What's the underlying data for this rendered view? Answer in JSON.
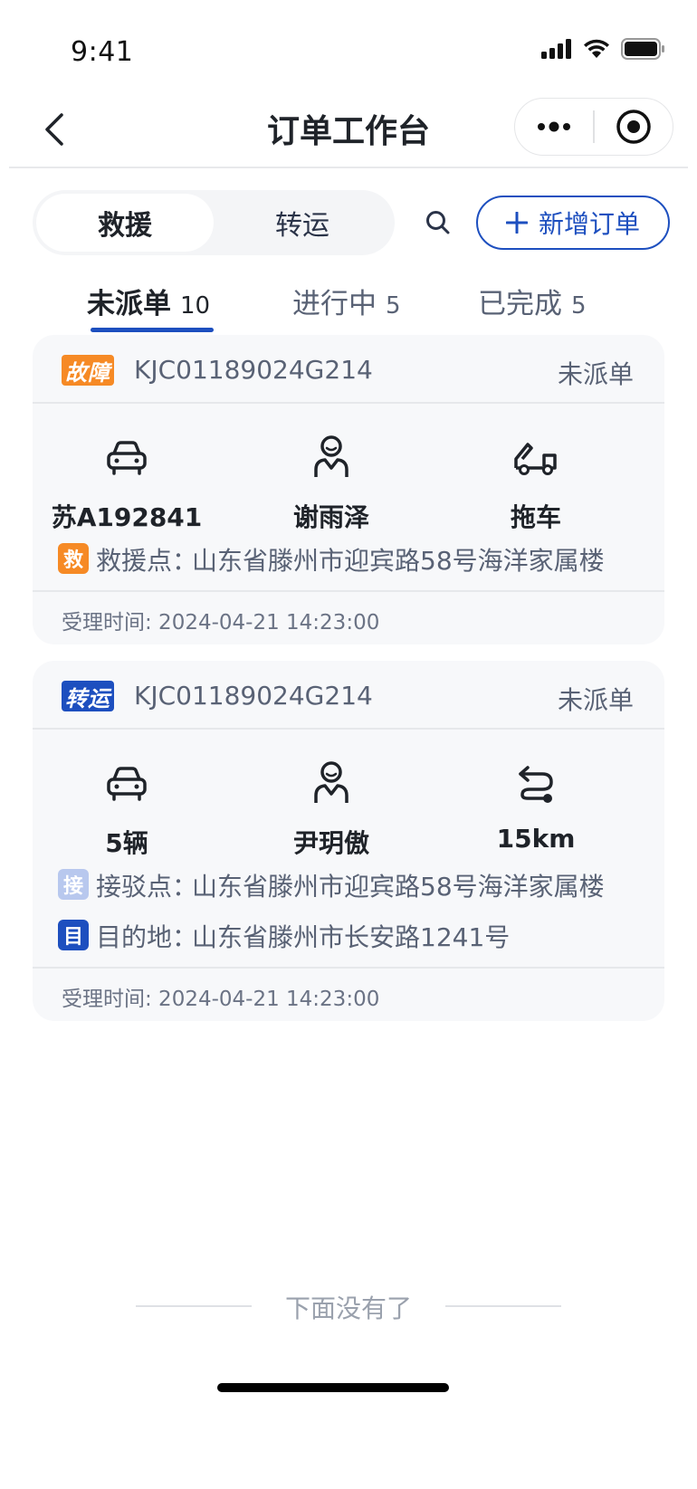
{
  "status_bar": {
    "time": "9:41"
  },
  "nav": {
    "title": "订单工作台"
  },
  "toolbar": {
    "segments": [
      "救援",
      "转运"
    ],
    "active_segment": "救援",
    "add_order_label": "新增订单"
  },
  "tabs": [
    {
      "label": "未派单",
      "count": "10",
      "active": true
    },
    {
      "label": "进行中",
      "count": "5",
      "active": false
    },
    {
      "label": "已完成",
      "count": "5",
      "active": false
    }
  ],
  "orders": [
    {
      "type_badge": "故障",
      "order_no": "KJC01189024G214",
      "status": "未派单",
      "info": [
        {
          "icon": "car-icon",
          "value": "苏A192841"
        },
        {
          "icon": "driver-icon",
          "value": "谢雨泽"
        },
        {
          "icon": "tow-truck-icon",
          "value": "拖车"
        }
      ],
      "addresses": [
        {
          "tag": "救",
          "label": "救援点：",
          "text": "山东省滕州市迎宾路58号海洋家属楼"
        }
      ],
      "accept_time": "受理时间: 2024-04-21 14:23:00"
    },
    {
      "type_badge": "转运",
      "order_no": "KJC01189024G214",
      "status": "未派单",
      "info": [
        {
          "icon": "car-icon",
          "value": "5辆"
        },
        {
          "icon": "driver-icon",
          "value": "尹玥傲"
        },
        {
          "icon": "route-icon",
          "value": "15km"
        }
      ],
      "addresses": [
        {
          "tag": "接",
          "label": "接驳点：",
          "text": "山东省滕州市迎宾路58号海洋家属楼"
        },
        {
          "tag": "目",
          "label": "目的地：",
          "text": "山东省滕州市长安路1241号"
        }
      ],
      "accept_time": "受理时间: 2024-04-21 14:23:00"
    }
  ],
  "list_end_text": "下面没有了",
  "colors": {
    "primary": "#1d4fbf",
    "fault": "#f68a25",
    "pickup": "#b8c8ee"
  }
}
